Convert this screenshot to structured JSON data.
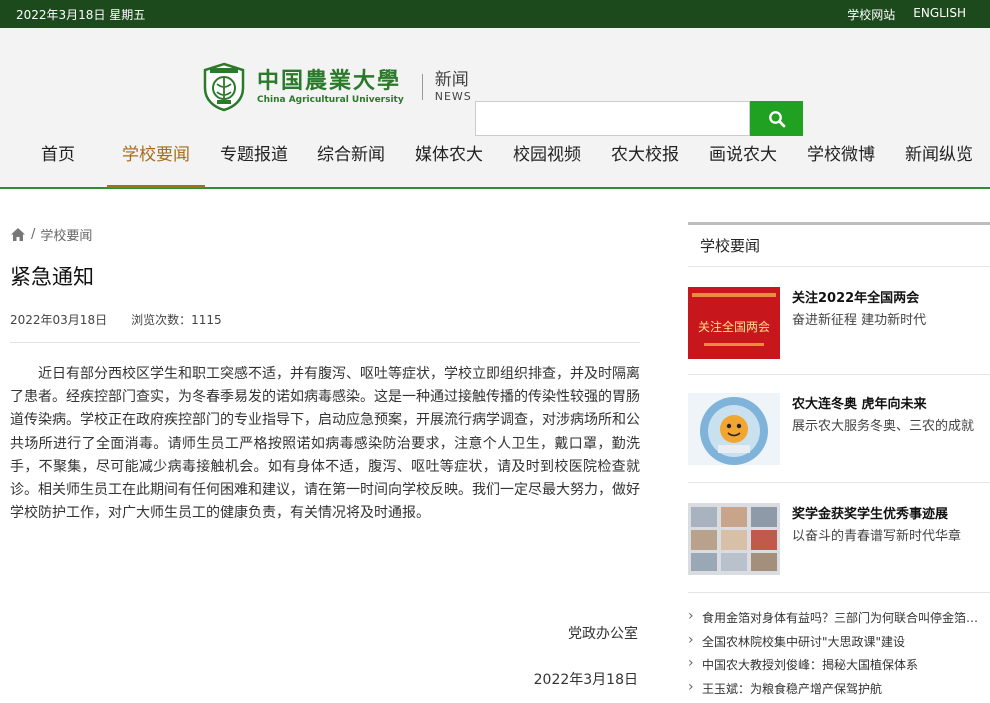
{
  "topbar": {
    "date": "2022年3月18日 星期五",
    "site_link": "学校网站",
    "english_link": "ENGLISH"
  },
  "brand": {
    "name_cn": "中国農業大學",
    "name_en": "China Agricultural University",
    "section_cn": "新闻",
    "section_en": "NEWS"
  },
  "search": {
    "value": "",
    "placeholder": ""
  },
  "nav": [
    "首页",
    "学校要闻",
    "专题报道",
    "综合新闻",
    "媒体农大",
    "校园视频",
    "农大校报",
    "画说农大",
    "学校微博",
    "新闻纵览"
  ],
  "nav_active": "学校要闻",
  "breadcrumb": {
    "current": "学校要闻"
  },
  "article": {
    "title": "紧急通知",
    "date": "2022年03月18日",
    "views": "浏览次数：1115",
    "body": "近日有部分西校区学生和职工突感不适，并有腹泻、呕吐等症状，学校立即组织排查，并及时隔离了患者。经疾控部门查实，为冬春季易发的诺如病毒感染。这是一种通过接触传播的传染性较强的胃肠道传染病。学校正在政府疾控部门的专业指导下，启动应急预案，开展流行病学调查，对涉病场所和公共场所进行了全面消毒。请师生员工严格按照诺如病毒感染防治要求，注意个人卫生，戴口罩，勤洗手，不聚集，尽可能减少病毒接触机会。如有身体不适，腹泻、呕吐等症状，请及时到校医院检查就诊。相关师生员工在此期间有任何困难和建议，请在第一时间向学校反映。我们一定尽最大努力，做好学校防护工作，对广大师生员工的健康负责，有关情况将及时通报。",
    "signature": "党政办公室",
    "sign_date": "2022年3月18日"
  },
  "sidebar": {
    "heading": "学校要闻",
    "cards": [
      {
        "title": "关注2022年全国两会",
        "subtitle": "奋进新征程 建功新时代",
        "thumb_text": "关注全国两会"
      },
      {
        "title": "农大连冬奥 虎年向未来",
        "subtitle": "展示农大服务冬奥、三农的成就"
      },
      {
        "title": "奖学金获奖学生优秀事迹展",
        "subtitle": "以奋斗的青春谱写新时代华章"
      }
    ],
    "news": [
      "食用金箔对身体有益吗？三部门为何联合叫停金箔…",
      "全国农林院校集中研讨\"大思政课\"建设",
      "中国农大教授刘俊峰：揭秘大国植保体系",
      "王玉斌：为粮食稳产增产保驾护航"
    ]
  },
  "colors": {
    "topbar": "#1d4a1c",
    "accent": "#a76b1e",
    "search_button": "#21a121",
    "brand_green": "#2a7a2a"
  }
}
